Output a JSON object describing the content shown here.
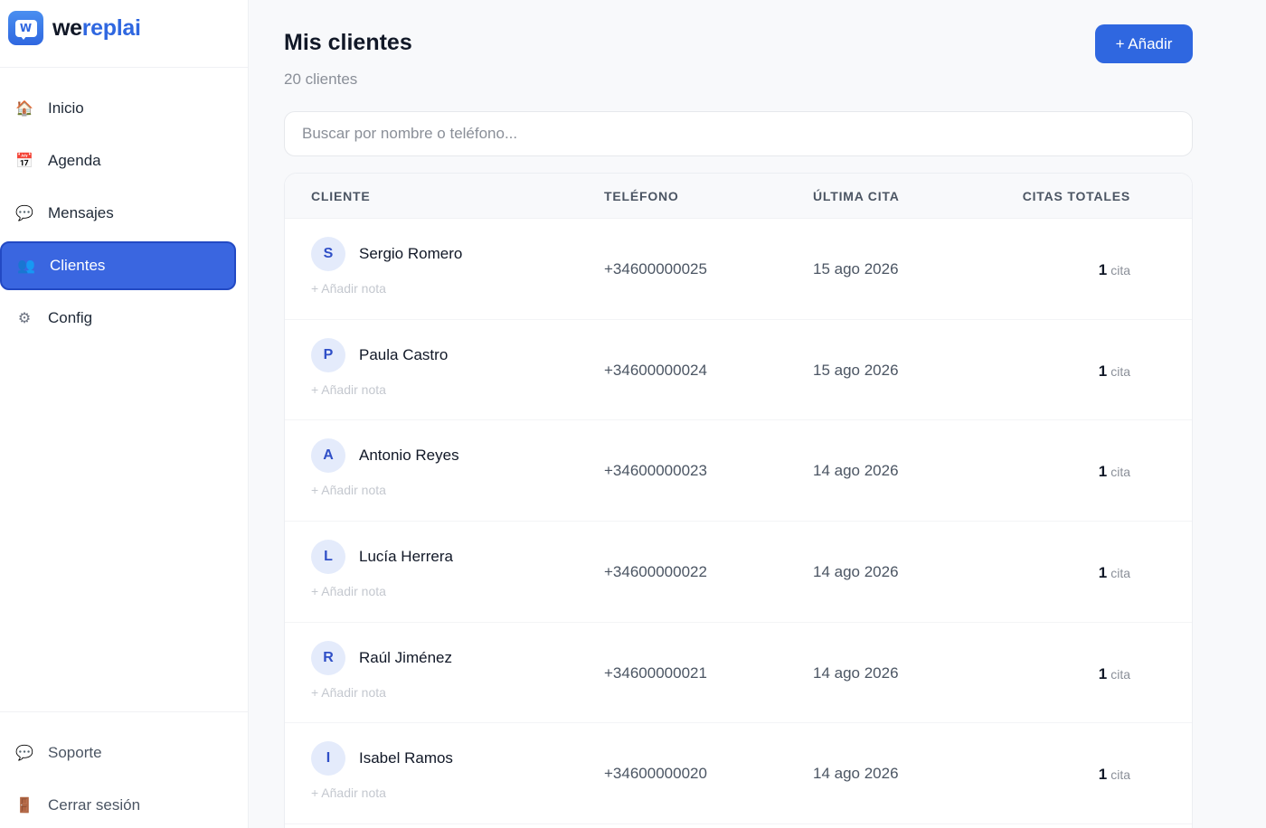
{
  "brand": {
    "prefix": "we",
    "suffix": "replai",
    "logo_letter": "W"
  },
  "nav": [
    {
      "label": "Inicio",
      "icon": "🏠",
      "icon_name": "home-icon",
      "active": false
    },
    {
      "label": "Agenda",
      "icon": "📅",
      "icon_name": "calendar-icon",
      "active": false
    },
    {
      "label": "Mensajes",
      "icon": "💬",
      "icon_name": "chat-icon",
      "active": false
    },
    {
      "label": "Clientes",
      "icon": "👥",
      "icon_name": "users-icon",
      "active": true
    },
    {
      "label": "Config",
      "icon": "⚙",
      "icon_name": "gear-icon",
      "active": false
    }
  ],
  "bottom_nav": [
    {
      "label": "Soporte",
      "icon": "💬",
      "icon_name": "support-icon"
    },
    {
      "label": "Cerrar sesión",
      "icon": "🚪",
      "icon_name": "door-icon"
    }
  ],
  "header": {
    "title": "Mis clientes",
    "subtitle": "20 clientes",
    "add_label": "+ Añadir"
  },
  "search": {
    "placeholder": "Buscar por nombre o teléfono...",
    "value": ""
  },
  "table": {
    "columns": [
      "CLIENTE",
      "TELÉFONO",
      "ÚLTIMA CITA",
      "CITAS TOTALES"
    ],
    "note_label": "+ Añadir nota",
    "rows": [
      {
        "initial": "S",
        "name": "Sergio Romero",
        "phone": "+34600000025",
        "last": "15 ago 2026",
        "total": "1",
        "unit": "cita"
      },
      {
        "initial": "P",
        "name": "Paula Castro",
        "phone": "+34600000024",
        "last": "15 ago 2026",
        "total": "1",
        "unit": "cita"
      },
      {
        "initial": "A",
        "name": "Antonio Reyes",
        "phone": "+34600000023",
        "last": "14 ago 2026",
        "total": "1",
        "unit": "cita"
      },
      {
        "initial": "L",
        "name": "Lucía Herrera",
        "phone": "+34600000022",
        "last": "14 ago 2026",
        "total": "1",
        "unit": "cita"
      },
      {
        "initial": "R",
        "name": "Raúl Jiménez",
        "phone": "+34600000021",
        "last": "14 ago 2026",
        "total": "1",
        "unit": "cita"
      },
      {
        "initial": "I",
        "name": "Isabel Ramos",
        "phone": "+34600000020",
        "last": "14 ago 2026",
        "total": "1",
        "unit": "cita"
      }
    ]
  },
  "colors": {
    "accent": "#2f67e0",
    "active_nav": "#3a66e0",
    "avatar_bg": "#e4ebfb"
  }
}
